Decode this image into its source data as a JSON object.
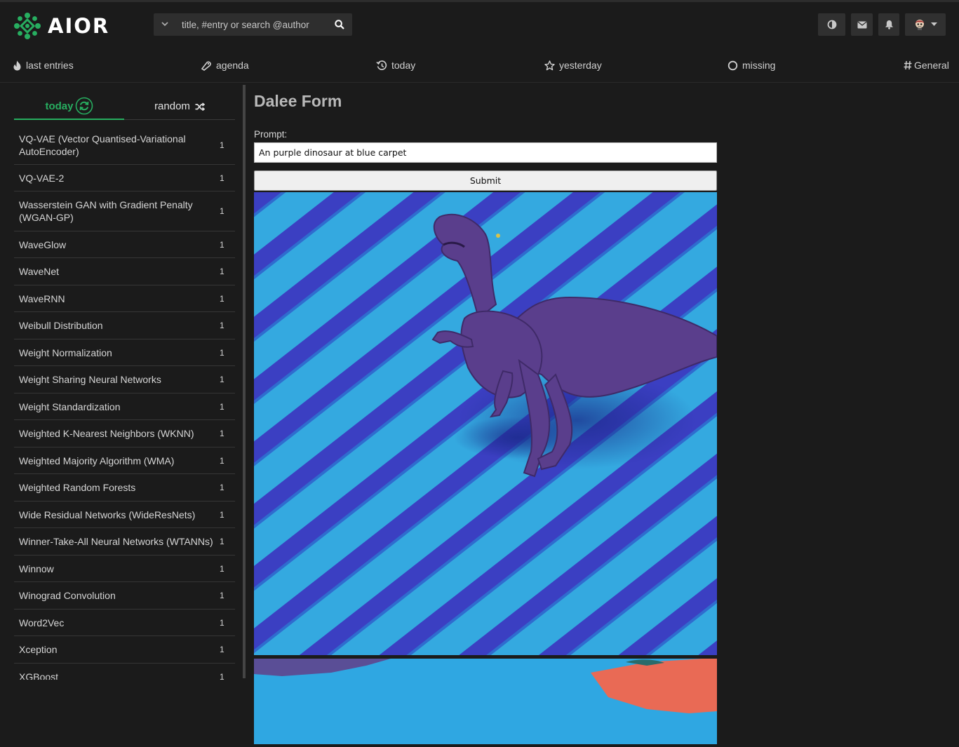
{
  "app": {
    "logo_text": "AIOR",
    "accent": "#27ae60"
  },
  "search": {
    "placeholder": "title, #entry or search @author",
    "value": ""
  },
  "toolbar": {
    "icons": [
      "contrast-icon",
      "mail-icon",
      "bell-icon",
      "avatar",
      "chevron-down-icon"
    ]
  },
  "nav": {
    "items": [
      {
        "label": "last entries",
        "icon": "flame-icon"
      },
      {
        "label": "agenda",
        "icon": "calendar-icon"
      },
      {
        "label": "today",
        "icon": "history-icon"
      },
      {
        "label": "yesterday",
        "icon": "star-icon"
      },
      {
        "label": "missing",
        "icon": "circle-icon"
      },
      {
        "label": "General",
        "icon": "hash-icon"
      }
    ]
  },
  "sidebar": {
    "tabs": [
      {
        "label": "today",
        "icon": "refresh-icon",
        "active": true
      },
      {
        "label": "random",
        "icon": "shuffle-icon",
        "active": false
      }
    ],
    "items": [
      {
        "label": "VQ-VAE (Vector Quantised-Variational AutoEncoder)",
        "count": "1"
      },
      {
        "label": "VQ-VAE-2",
        "count": "1"
      },
      {
        "label": "Wasserstein GAN with Gradient Penalty (WGAN-GP)",
        "count": "1"
      },
      {
        "label": "WaveGlow",
        "count": "1"
      },
      {
        "label": "WaveNet",
        "count": "1"
      },
      {
        "label": "WaveRNN",
        "count": "1"
      },
      {
        "label": "Weibull Distribution",
        "count": "1"
      },
      {
        "label": "Weight Normalization",
        "count": "1"
      },
      {
        "label": "Weight Sharing Neural Networks",
        "count": "1"
      },
      {
        "label": "Weight Standardization",
        "count": "1"
      },
      {
        "label": "Weighted K-Nearest Neighbors (WKNN)",
        "count": "1"
      },
      {
        "label": "Weighted Majority Algorithm (WMA)",
        "count": "1"
      },
      {
        "label": "Weighted Random Forests",
        "count": "1"
      },
      {
        "label": "Wide Residual Networks (WideResNets)",
        "count": "1"
      },
      {
        "label": "Winner-Take-All Neural Networks (WTANNs)",
        "count": "1"
      },
      {
        "label": "Winnow",
        "count": "1"
      },
      {
        "label": "Winograd Convolution",
        "count": "1"
      },
      {
        "label": "Word2Vec",
        "count": "1"
      },
      {
        "label": "Xception",
        "count": "1"
      },
      {
        "label": "XGBoost",
        "count": "1"
      }
    ]
  },
  "form": {
    "title": "Dalee Form",
    "prompt_label": "Prompt:",
    "prompt_value": "An purple dinosaur at blue carpet",
    "submit_label": "Submit"
  }
}
